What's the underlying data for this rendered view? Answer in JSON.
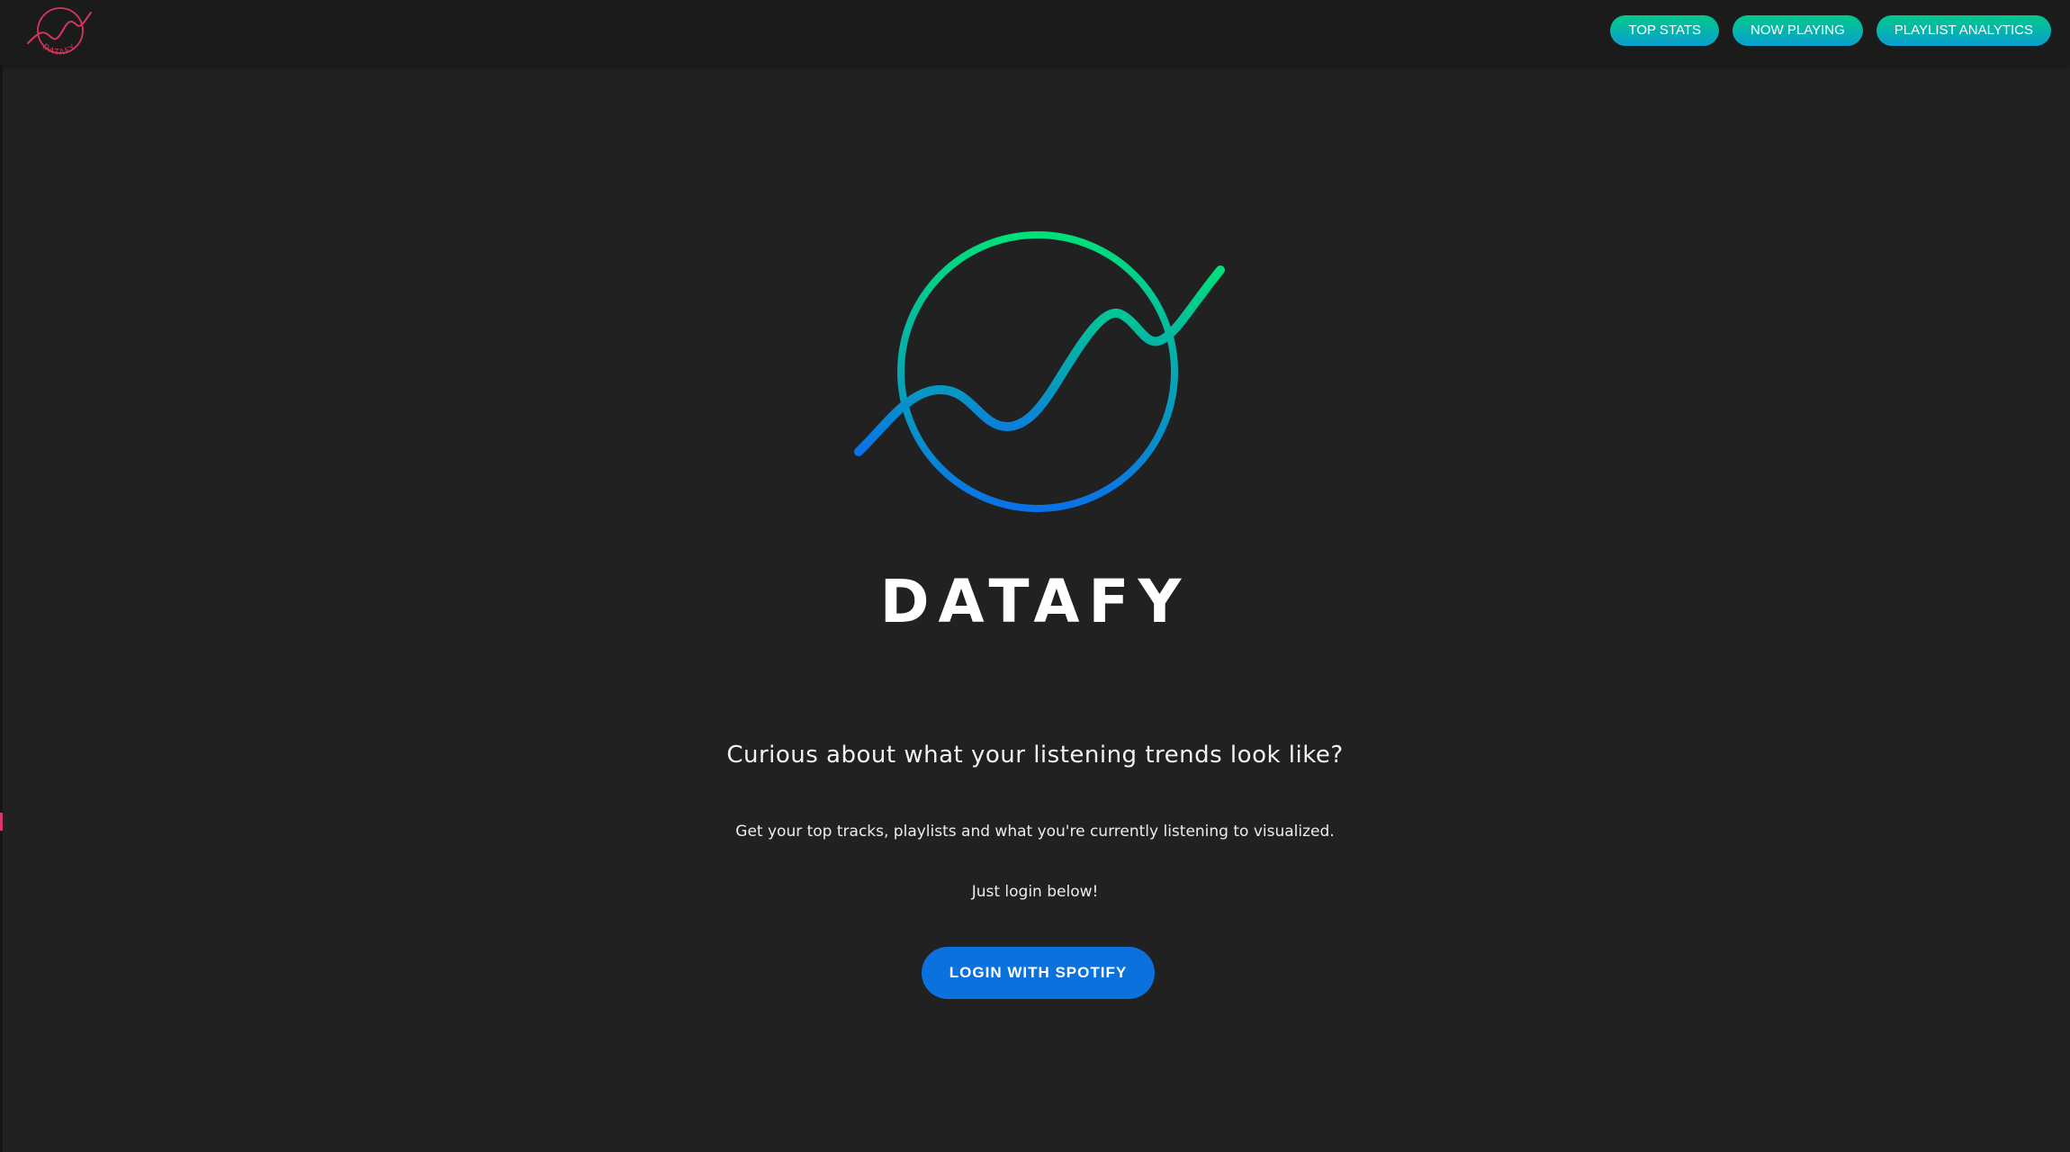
{
  "header": {
    "logo_icon": "datafy-logo-icon",
    "logo_text": "DATAFY",
    "logo_color": "#d6365a",
    "nav": [
      {
        "label": "TOP STATS"
      },
      {
        "label": "NOW PLAYING"
      },
      {
        "label": "PLAYLIST ANALYTICS"
      }
    ],
    "nav_gradient": [
      "#00c98a",
      "#0b9fcf"
    ]
  },
  "hero": {
    "logo_icon": "datafy-wave-circle-icon",
    "logo_gradient": [
      "#00e07a",
      "#0a72e8"
    ],
    "title": "DATAFY",
    "tagline": "Curious about what your listening trends look like?",
    "description": "Get your top tracks, playlists and what you're currently listening to visualized.",
    "cta_hint": "Just login below!",
    "login_button": "LOGIN WITH SPOTIFY",
    "login_color": "#0b72dd"
  },
  "colors": {
    "background": "#212121",
    "topbar": "#1b1b1b"
  }
}
